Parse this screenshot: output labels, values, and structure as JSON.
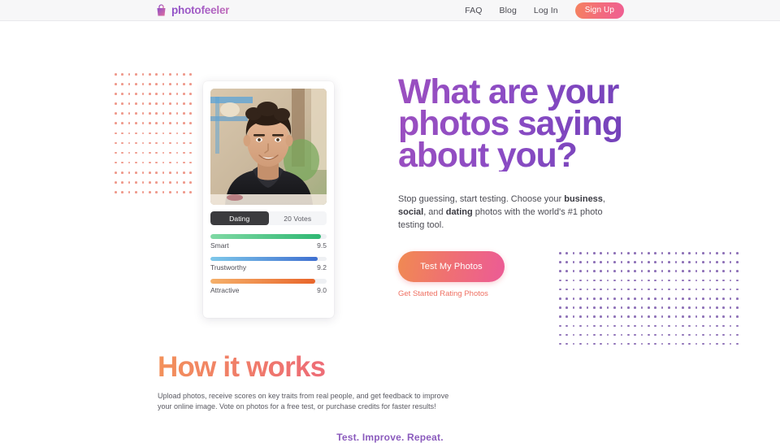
{
  "header": {
    "brand": {
      "name": "photofeeler",
      "icon": "photofeeler-bag-icon"
    },
    "nav": [
      {
        "label": "FAQ",
        "name": "nav-link-faq"
      },
      {
        "label": "Blog",
        "name": "nav-link-blog"
      },
      {
        "label": "Log In",
        "name": "nav-link-login"
      }
    ],
    "signup_label": "Sign Up"
  },
  "hero": {
    "headline": "What are your\nphotos saying\nabout you?",
    "subcopy": {
      "part1": "Stop guessing, start testing. Choose your ",
      "bold1": "business",
      "part2": ", ",
      "bold2": "social",
      "part3": ", and ",
      "bold3": "dating",
      "part4": " photos with the world's #1 photo testing tool."
    },
    "cta_label": "Test My Photos",
    "cta_sub_label": "Get Started Rating Photos"
  },
  "photo_card": {
    "category_label": "Dating",
    "votes_label": "20 Votes",
    "traits": [
      {
        "name": "Smart",
        "score": "9.5",
        "percent": 95,
        "color": "#2fb873"
      },
      {
        "name": "Trustworthy",
        "score": "9.2",
        "percent": 92,
        "color": "#3f6fd0"
      },
      {
        "name": "Attractive",
        "score": "9.0",
        "percent": 90,
        "color": "#e8652a"
      }
    ]
  },
  "how_it_works": {
    "title": "How it works",
    "description": "Upload photos, receive scores on key traits from real people, and get feedback to improve your online image. Vote on photos for a free test, or purchase credits for faster results!"
  },
  "tagline": "Test. Improve. Repeat.",
  "colors": {
    "accent_pink": "#ef5f93",
    "accent_orange": "#f5825f",
    "purple": "#8b4cc4",
    "dots_left": "#ef9a8c",
    "dots_right": "#8f72b8"
  }
}
